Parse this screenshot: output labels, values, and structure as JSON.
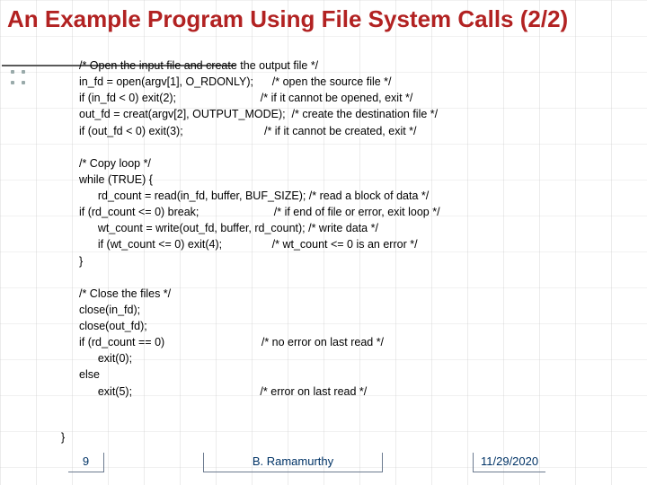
{
  "title": "An Example Program Using File System Calls (2/2)",
  "code_lines": [
    "/* Open the input file and create the output file */",
    "in_fd = open(argv[1], O_RDONLY);      /* open the source file */",
    "if (in_fd < 0) exit(2);                           /* if it cannot be opened, exit */",
    "out_fd = creat(argv[2], OUTPUT_MODE);  /* create the destination file */",
    "if (out_fd < 0) exit(3);                          /* if it cannot be created, exit */",
    "",
    "/* Copy loop */",
    "while (TRUE) {",
    "      rd_count = read(in_fd, buffer, BUF_SIZE); /* read a block of data */",
    "if (rd_count <= 0) break;                        /* if end of file or error, exit loop */",
    "      wt_count = write(out_fd, buffer, rd_count); /* write data */",
    "      if (wt_count <= 0) exit(4);                /* wt_count <= 0 is an error */",
    "}",
    "",
    "/* Close the files */",
    "close(in_fd);",
    "close(out_fd);",
    "if (rd_count == 0)                               /* no error on last read */",
    "      exit(0);",
    "else",
    "      exit(5);                                         /* error on last read */"
  ],
  "code_end_brace": "}",
  "footer": {
    "slide_number": "9",
    "author": "B. Ramamurthy",
    "date": "11/29/2020"
  }
}
